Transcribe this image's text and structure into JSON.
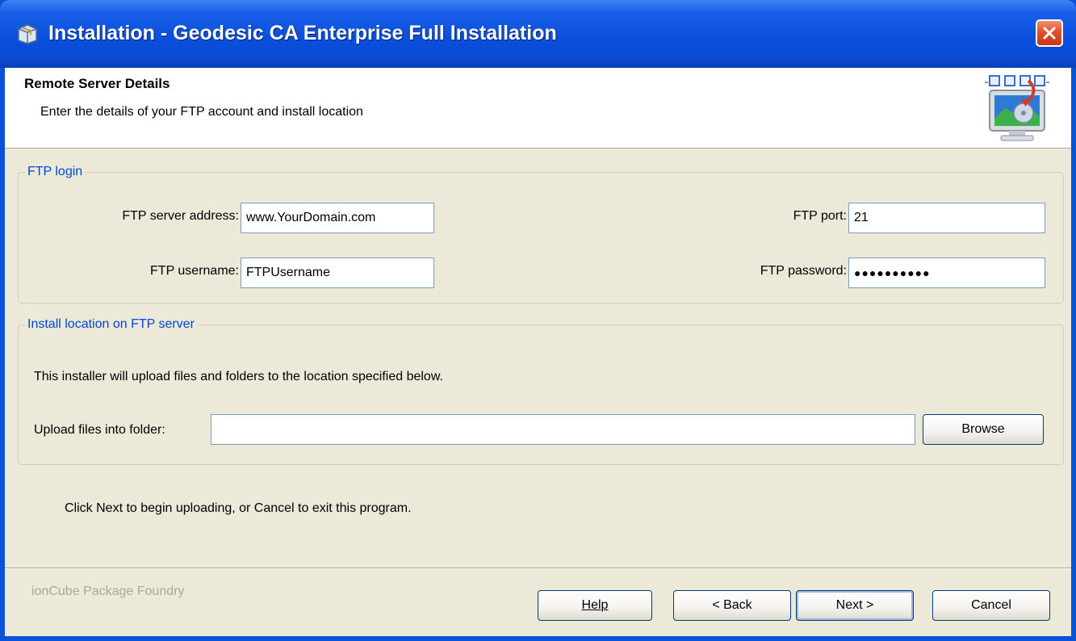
{
  "window": {
    "title": "Installation - Geodesic CA Enterprise Full Installation"
  },
  "header": {
    "title": "Remote Server Details",
    "subtitle": "Enter the details of your FTP account and install location"
  },
  "ftp_login": {
    "legend": "FTP login",
    "server_label": "FTP server address:",
    "server_value": "www.YourDomain.com",
    "port_label": "FTP port:",
    "port_value": "21",
    "username_label": "FTP username:",
    "username_value": "FTPUsername",
    "password_label": "FTP password:",
    "password_value": "●●●●●●●●●●"
  },
  "install_location": {
    "legend": "Install location on FTP server",
    "description": "This installer will upload files and folders to the location specified below.",
    "folder_label": "Upload files into folder:",
    "folder_value": "",
    "browse_label": "Browse"
  },
  "info_text": "Click Next to begin uploading, or Cancel to exit this program.",
  "footer": {
    "brand": "ionCube Package Foundry",
    "help_label": "Help",
    "back_label": "< Back",
    "next_label": "Next >",
    "cancel_label": "Cancel"
  },
  "colors": {
    "title_bar": "#0a4ad4",
    "dialog_bg": "#ece9d8",
    "legend_text": "#0046d5",
    "close_button": "#e0512a"
  },
  "icons": {
    "app": "installer-box-icon",
    "close": "close-icon",
    "header": "monitor-install-graphic"
  }
}
